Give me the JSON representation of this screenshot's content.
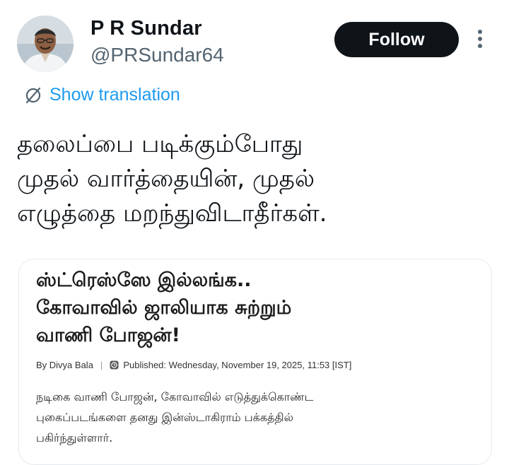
{
  "author": {
    "display_name": "P R Sundar",
    "handle": "@PRSundar64",
    "avatar_icon": "person-avatar"
  },
  "header": {
    "follow_label": "Follow",
    "more_icon": "vertical-ellipsis-icon"
  },
  "translation": {
    "label": "Show translation",
    "icon": "globe-slash-icon",
    "color": "#1d9bf0"
  },
  "tweet": {
    "lines": [
      "தலைப்பை படிக்கும்போது",
      "முதல் வார்த்தையின், முதல்",
      "எழுத்தை மறந்துவிடாதீர்கள்."
    ]
  },
  "card": {
    "headline_lines": [
      "ஸ்ட்ரெஸ்ஸே இல்லங்க..",
      "கோவாவில் ஜாலியாக சுற்றும்",
      "வாணி போஜன்!"
    ],
    "byline": "By Divya Bala",
    "separator": "|",
    "published": "Published: Wednesday, November 19, 2025, 11:53 [IST]",
    "summary_lines": [
      "நடிகை வாணி போஜன், கோவாவில் எடுத்துக்கொண்ட",
      "புகைப்படங்களை தனது இன்ஸ்டாகிராம் பக்கத்தில்",
      "பகிர்ந்துள்ளார்."
    ]
  }
}
